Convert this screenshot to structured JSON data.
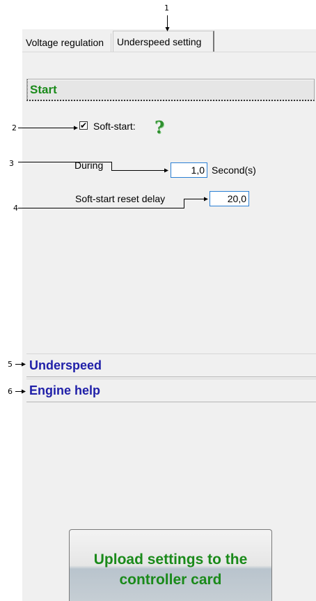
{
  "tabs": [
    {
      "label": "Voltage regulation",
      "active": false
    },
    {
      "label": "Underspeed setting",
      "active": true
    }
  ],
  "sections": {
    "start": {
      "title": "Start"
    },
    "underspeed": {
      "title": "Underspeed"
    },
    "engine_help": {
      "title": "Engine help"
    }
  },
  "soft_start": {
    "checked": true,
    "check_glyph": "✔",
    "label": "Soft-start:",
    "help_icon": "help-question-icon",
    "help_glyph": "?"
  },
  "during": {
    "label": "During",
    "value": "1,0",
    "unit": "Second(s)"
  },
  "reset_delay": {
    "label": "Soft-start reset delay",
    "value": "20,0"
  },
  "upload_button": {
    "label": "Upload settings to the controller card"
  },
  "callouts": [
    "1",
    "2",
    "3",
    "4",
    "5",
    "6"
  ],
  "colors": {
    "section_green": "#1a8a1a",
    "section_blue": "#1f1fa8",
    "input_border": "#2a7fd4"
  }
}
